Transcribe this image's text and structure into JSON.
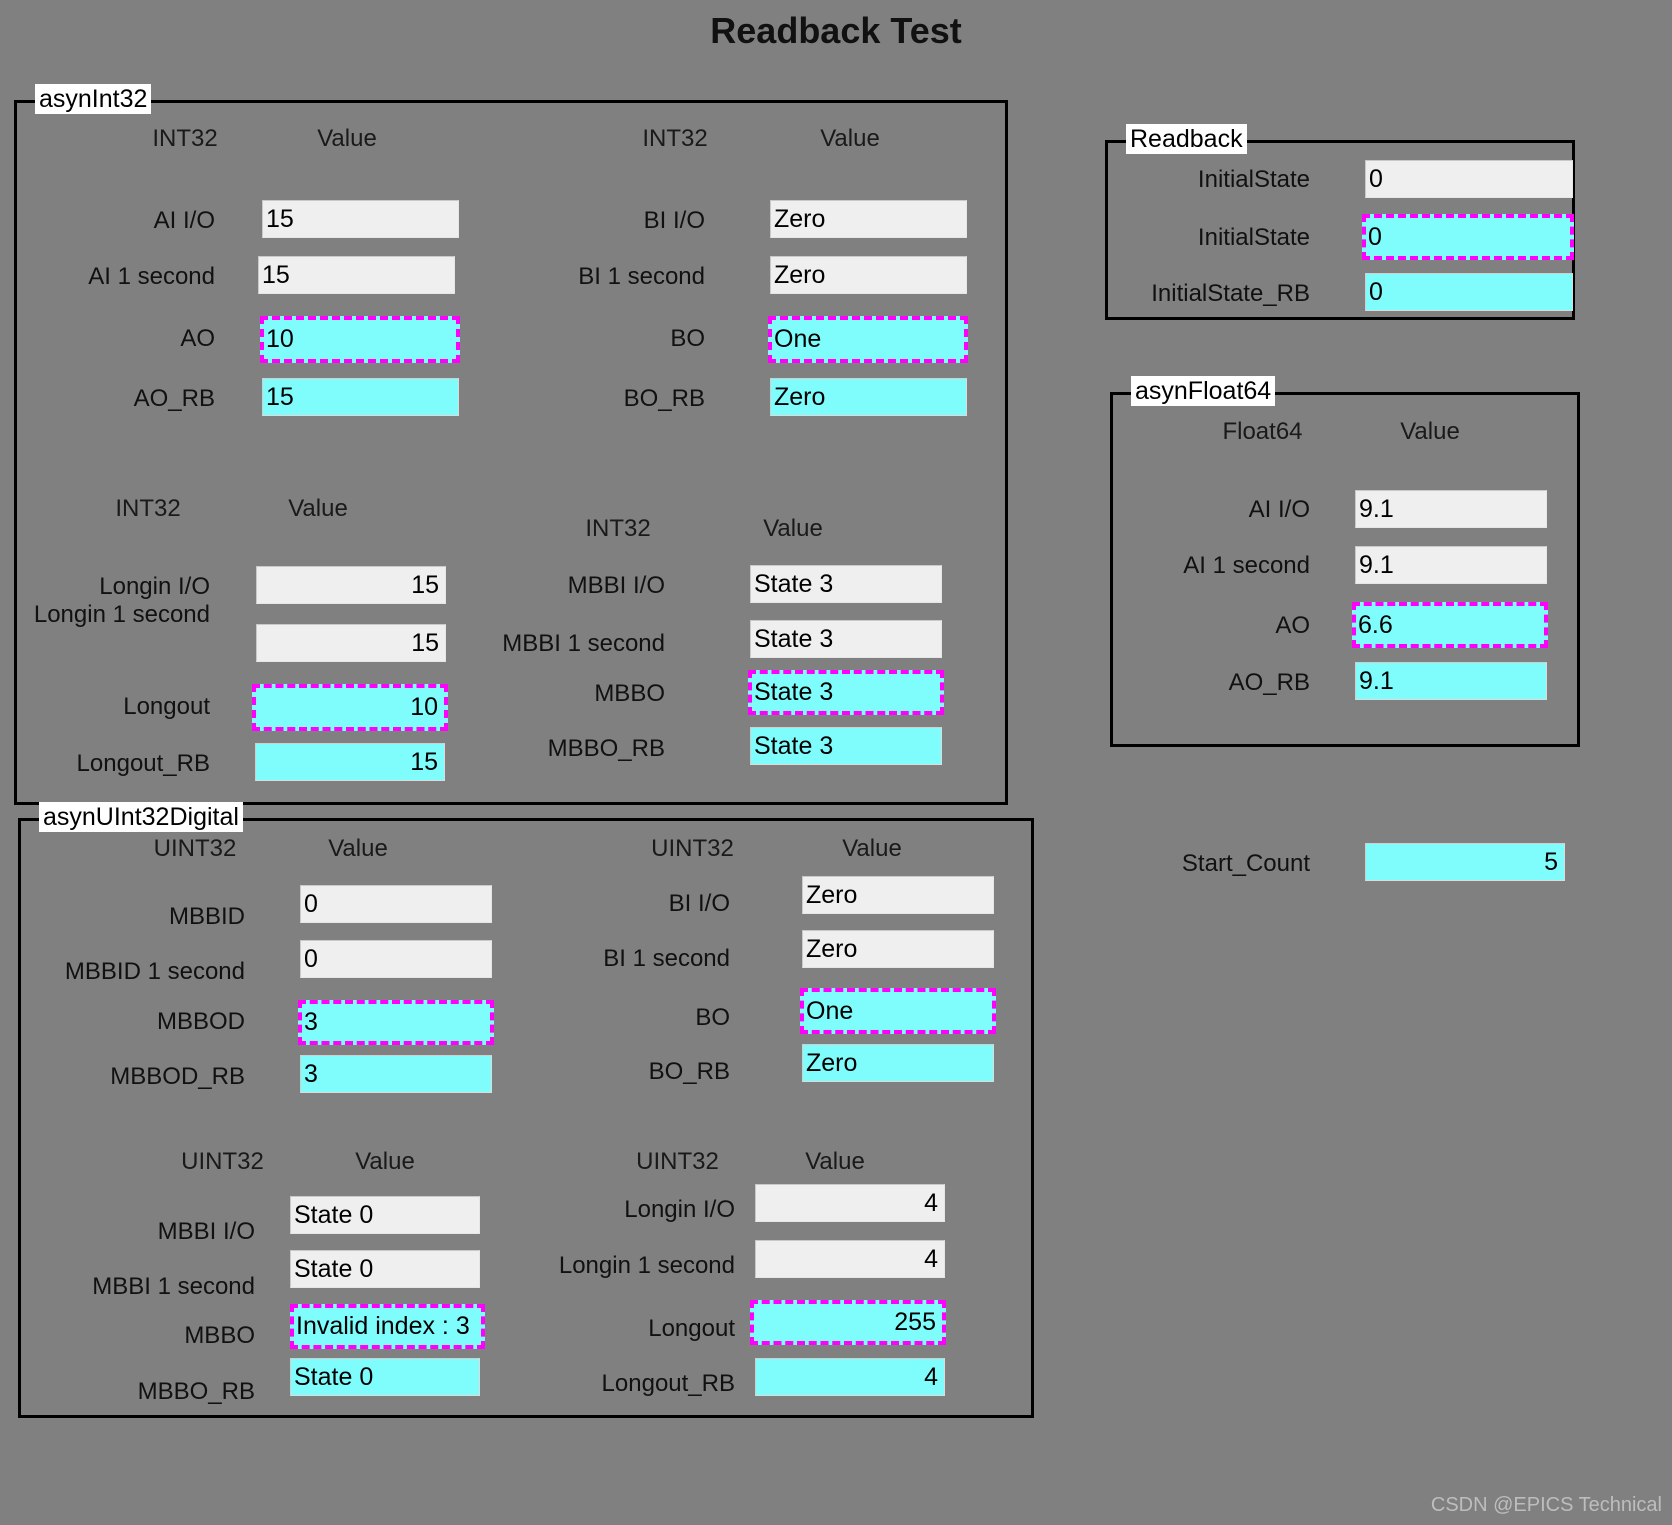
{
  "title": "Readback Test",
  "watermark": "CSDN @EPICS Technical",
  "colors": {
    "background": "#808080",
    "readonly_field": "#efefef",
    "readback_field": "#7ffdfd",
    "focus_border": "#ff00ff",
    "frame": "#000000",
    "watermark_text": "#bdbdbd"
  },
  "groups": {
    "asynInt32": {
      "label": "asynInt32",
      "quadrants": [
        {
          "header_type": "INT32",
          "header_value": "Value",
          "rows": [
            {
              "label": "AI I/O",
              "value": "15",
              "style": "ro",
              "align": "left"
            },
            {
              "label": "AI 1 second",
              "value": "15",
              "style": "ro",
              "align": "left"
            },
            {
              "label": "AO",
              "value": "10",
              "style": "sel",
              "align": "left"
            },
            {
              "label": "AO_RB",
              "value": "15",
              "style": "cy",
              "align": "left"
            }
          ]
        },
        {
          "header_type": "INT32",
          "header_value": "Value",
          "rows": [
            {
              "label": "BI I/O",
              "value": "Zero",
              "style": "ro",
              "align": "left"
            },
            {
              "label": "BI 1 second",
              "value": "Zero",
              "style": "ro",
              "align": "left"
            },
            {
              "label": "BO",
              "value": "One",
              "style": "sel",
              "align": "left"
            },
            {
              "label": "BO_RB",
              "value": "Zero",
              "style": "cy",
              "align": "left"
            }
          ]
        },
        {
          "header_type": "INT32",
          "header_value": "Value",
          "rows": [
            {
              "label": "Longin I/O",
              "value": "15",
              "style": "ro",
              "align": "right"
            },
            {
              "label": "Longin 1 second",
              "value": "15",
              "style": "ro",
              "align": "right"
            },
            {
              "label": "Longout",
              "value": "10",
              "style": "sel",
              "align": "right"
            },
            {
              "label": "Longout_RB",
              "value": "15",
              "style": "cy",
              "align": "right"
            }
          ]
        },
        {
          "header_type": "INT32",
          "header_value": "Value",
          "rows": [
            {
              "label": "MBBI I/O",
              "value": "State 3",
              "style": "ro",
              "align": "left"
            },
            {
              "label": "MBBI 1 second",
              "value": "State 3",
              "style": "ro",
              "align": "left"
            },
            {
              "label": "MBBO",
              "value": "State 3",
              "style": "sel",
              "align": "left"
            },
            {
              "label": "MBBO_RB",
              "value": "State 3",
              "style": "cy",
              "align": "left"
            }
          ]
        }
      ]
    },
    "asynUInt32Digital": {
      "label": "asynUInt32Digital",
      "quadrants": [
        {
          "header_type": "UINT32",
          "header_value": "Value",
          "rows": [
            {
              "label": "MBBID",
              "value": "0",
              "style": "ro",
              "align": "left"
            },
            {
              "label": "MBBID 1 second",
              "value": "0",
              "style": "ro",
              "align": "left"
            },
            {
              "label": "MBBOD",
              "value": "3",
              "style": "sel",
              "align": "left"
            },
            {
              "label": "MBBOD_RB",
              "value": "3",
              "style": "cy",
              "align": "left"
            }
          ]
        },
        {
          "header_type": "UINT32",
          "header_value": "Value",
          "rows": [
            {
              "label": "BI I/O",
              "value": "Zero",
              "style": "ro",
              "align": "left"
            },
            {
              "label": "BI 1 second",
              "value": "Zero",
              "style": "ro",
              "align": "left"
            },
            {
              "label": "BO",
              "value": "One",
              "style": "sel",
              "align": "left"
            },
            {
              "label": "BO_RB",
              "value": "Zero",
              "style": "cy",
              "align": "left"
            }
          ]
        },
        {
          "header_type": "UINT32",
          "header_value": "Value",
          "rows": [
            {
              "label": "MBBI I/O",
              "value": "State 0",
              "style": "ro",
              "align": "left"
            },
            {
              "label": "MBBI 1 second",
              "value": "State 0",
              "style": "ro",
              "align": "left"
            },
            {
              "label": "MBBO",
              "value": "Invalid index : 3",
              "style": "sel",
              "align": "left"
            },
            {
              "label": "MBBO_RB",
              "value": "State 0",
              "style": "cy",
              "align": "left"
            }
          ]
        },
        {
          "header_type": "UINT32",
          "header_value": "Value",
          "rows": [
            {
              "label": "Longin I/O",
              "value": "4",
              "style": "ro",
              "align": "right"
            },
            {
              "label": "Longin 1 second",
              "value": "4",
              "style": "ro",
              "align": "right"
            },
            {
              "label": "Longout",
              "value": "255",
              "style": "sel",
              "align": "right"
            },
            {
              "label": "Longout_RB",
              "value": "4",
              "style": "cy",
              "align": "right"
            }
          ]
        }
      ]
    },
    "readback": {
      "label": "Readback",
      "rows": [
        {
          "label": "InitialState",
          "value": "0",
          "style": "ro",
          "align": "left"
        },
        {
          "label": "InitialState",
          "value": "0",
          "style": "sel",
          "align": "left"
        },
        {
          "label": "InitialState_RB",
          "value": "0",
          "style": "cy",
          "align": "left"
        }
      ]
    },
    "asynFloat64": {
      "label": "asynFloat64",
      "header_type": "Float64",
      "header_value": "Value",
      "rows": [
        {
          "label": "AI I/O",
          "value": "9.1",
          "style": "ro",
          "align": "left"
        },
        {
          "label": "AI 1 second",
          "value": "9.1",
          "style": "ro",
          "align": "left"
        },
        {
          "label": "AO",
          "value": "6.6",
          "style": "sel",
          "align": "left"
        },
        {
          "label": "AO_RB",
          "value": "9.1",
          "style": "cy",
          "align": "left"
        }
      ]
    }
  },
  "start_count": {
    "label": "Start_Count",
    "value": "5",
    "style": "cy",
    "align": "right"
  }
}
